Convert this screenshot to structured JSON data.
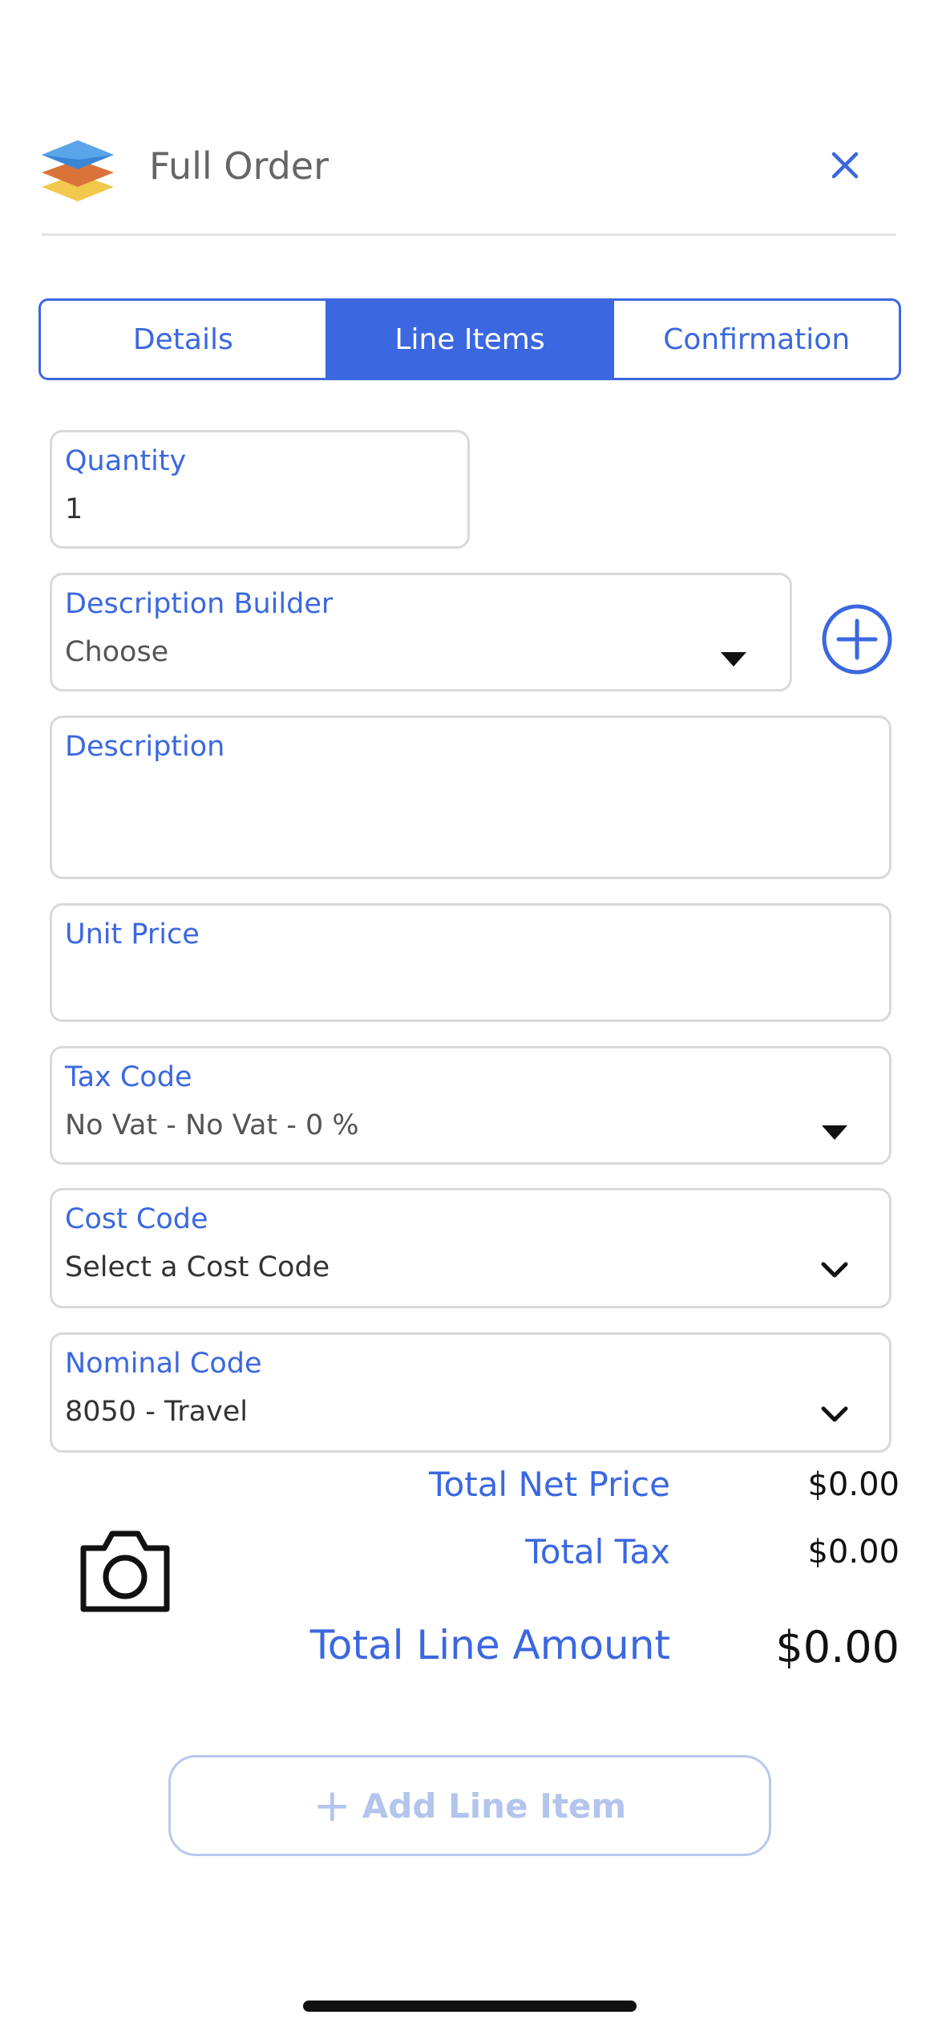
{
  "header": {
    "title": "Full Order"
  },
  "tabs": [
    {
      "label": "Details",
      "active": false
    },
    {
      "label": "Line Items",
      "active": true
    },
    {
      "label": "Confirmation",
      "active": false
    }
  ],
  "form": {
    "quantity": {
      "label": "Quantity",
      "value": "1"
    },
    "description_builder": {
      "label": "Description Builder",
      "value": "Choose"
    },
    "description": {
      "label": "Description",
      "value": ""
    },
    "unit_price": {
      "label": "Unit Price",
      "value": ""
    },
    "tax_code": {
      "label": "Tax Code",
      "value": "No Vat - No Vat - 0 %"
    },
    "cost_code": {
      "label": "Cost Code",
      "value": "Select a Cost Code"
    },
    "nominal_code": {
      "label": "Nominal Code",
      "value": "8050 - Travel"
    }
  },
  "totals": {
    "net_price_label": "Total Net Price",
    "net_price_value": "$0.00",
    "tax_label": "Total Tax",
    "tax_value": "$0.00",
    "line_amount_label": "Total Line Amount",
    "line_amount_value": "$0.00"
  },
  "actions": {
    "add_line_item_label": "Add Line Item",
    "add_line_item_icon": "+"
  },
  "colors": {
    "accent": "#3b68e0",
    "disabled": "#b3c4ee",
    "border": "#d9d9d9"
  },
  "icons": [
    "app-logo-icon",
    "close-icon",
    "add-circle-icon",
    "dropdown-caret-icon",
    "chevron-down-icon",
    "camera-icon"
  ]
}
